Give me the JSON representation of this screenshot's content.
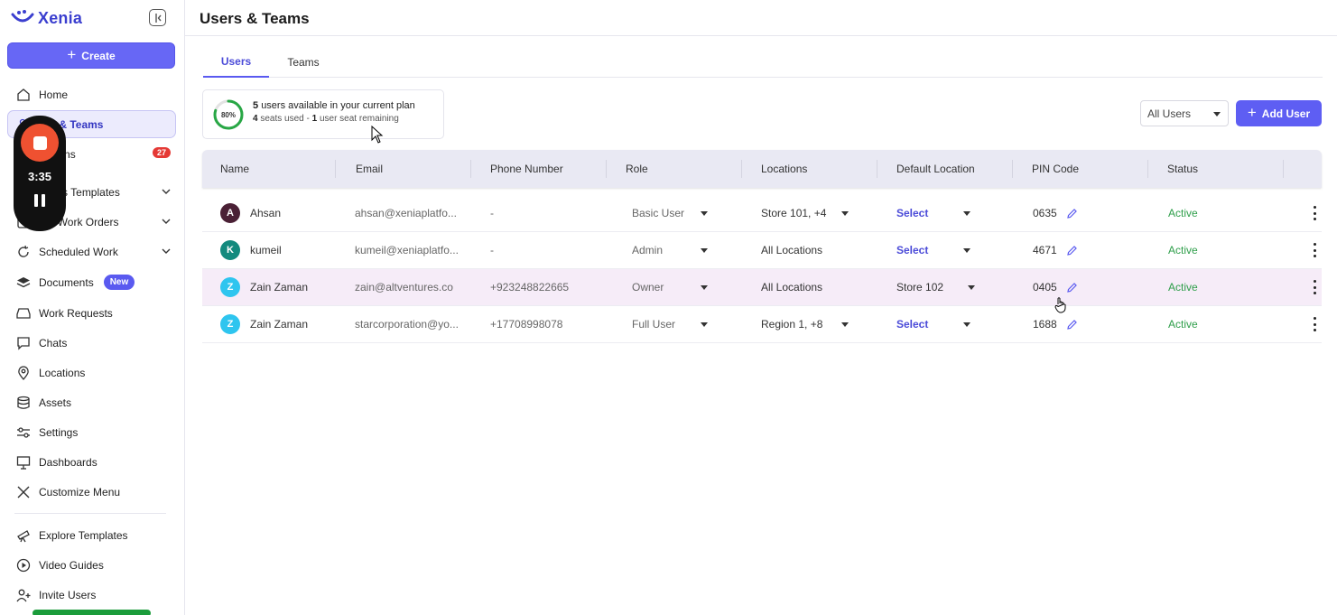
{
  "app": {
    "name": "Xenia",
    "brand_color": "#3b3fcf",
    "accent_color": "#5e5ef3"
  },
  "sidebar": {
    "create_label": "Create",
    "items": [
      {
        "label": "Home",
        "icon": "home-icon"
      },
      {
        "label": "Users & Teams",
        "icon": "users-icon",
        "active": true
      },
      {
        "label": "Operations",
        "icon": "bell-icon",
        "badge": "27"
      },
      {
        "label": "Operations Templates",
        "icon": "template-icon",
        "expandable": true
      },
      {
        "label": "Tasks & Work Orders",
        "icon": "tasks-icon",
        "expandable": true
      },
      {
        "label": "Scheduled Work",
        "icon": "refresh-icon",
        "expandable": true
      },
      {
        "label": "Documents",
        "icon": "layers-icon",
        "badge_new": "New"
      },
      {
        "label": "Work Requests",
        "icon": "inbox-icon"
      },
      {
        "label": "Chats",
        "icon": "chat-icon"
      },
      {
        "label": "Locations",
        "icon": "location-pin-icon"
      },
      {
        "label": "Assets",
        "icon": "database-icon"
      },
      {
        "label": "Settings",
        "icon": "sliders-icon"
      },
      {
        "label": "Dashboards",
        "icon": "dashboard-icon"
      },
      {
        "label": "Customize Menu",
        "icon": "tools-icon"
      },
      {
        "label": "Explore Templates",
        "icon": "telescope-icon"
      },
      {
        "label": "Video Guides",
        "icon": "play-icon"
      },
      {
        "label": "Invite Users",
        "icon": "user-plus-icon"
      }
    ],
    "visible_labels": {
      "users_teams": "ers & Teams",
      "operations": "ications",
      "op_templates": "ations Templates",
      "tasks": "s & Work Orders"
    }
  },
  "recorder": {
    "time": "3:35"
  },
  "header": {
    "title": "Users & Teams"
  },
  "tabs": [
    {
      "label": "Users",
      "active": true
    },
    {
      "label": "Teams",
      "active": false
    }
  ],
  "plan": {
    "percent_label": "80%",
    "percent": 80,
    "line1_count": "5",
    "line1_text": "users available in your current plan",
    "seats_used": "4",
    "seats_used_text": "seats used - ",
    "seats_remaining": "1",
    "seats_remaining_text": "user seat remaining"
  },
  "filter": {
    "selected": "All Users"
  },
  "add_user_label": "Add User",
  "table": {
    "headers": [
      "Name",
      "Email",
      "Phone Number",
      "Role",
      "Locations",
      "Default Location",
      "PIN Code",
      "Status"
    ],
    "rows": [
      {
        "initial": "A",
        "avatar_color": "#4a2035",
        "name": "Ahsan",
        "email": "ahsan@xeniaplatfo...",
        "phone": "-",
        "role": "Basic User",
        "locations": "Store 101, +4",
        "locations_dropdown": true,
        "default_location": "Select",
        "default_is_select": true,
        "pin": "0635",
        "status": "Active"
      },
      {
        "initial": "K",
        "avatar_color": "#138a7e",
        "name": "kumeil",
        "email": "kumeil@xeniaplatfo...",
        "phone": "-",
        "role": "Admin",
        "locations": "All Locations",
        "locations_dropdown": false,
        "default_location": "Select",
        "default_is_select": true,
        "pin": "4671",
        "status": "Active"
      },
      {
        "initial": "Z",
        "avatar_color": "#2ec5ef",
        "name": "Zain Zaman",
        "email": "zain@altventures.co",
        "phone": "+923248822665",
        "role": "Owner",
        "locations": "All Locations",
        "locations_dropdown": false,
        "default_location": "Store 102",
        "default_is_select": false,
        "pin": "0405",
        "status": "Active",
        "highlight": true
      },
      {
        "initial": "Z",
        "avatar_color": "#2ec5ef",
        "name": "Zain Zaman",
        "email": "starcorporation@yo...",
        "phone": "+17708998078",
        "role": "Full User",
        "locations": "Region 1, +8",
        "locations_dropdown": true,
        "default_location": "Select",
        "default_is_select": true,
        "pin": "1688",
        "status": "Active"
      }
    ]
  }
}
